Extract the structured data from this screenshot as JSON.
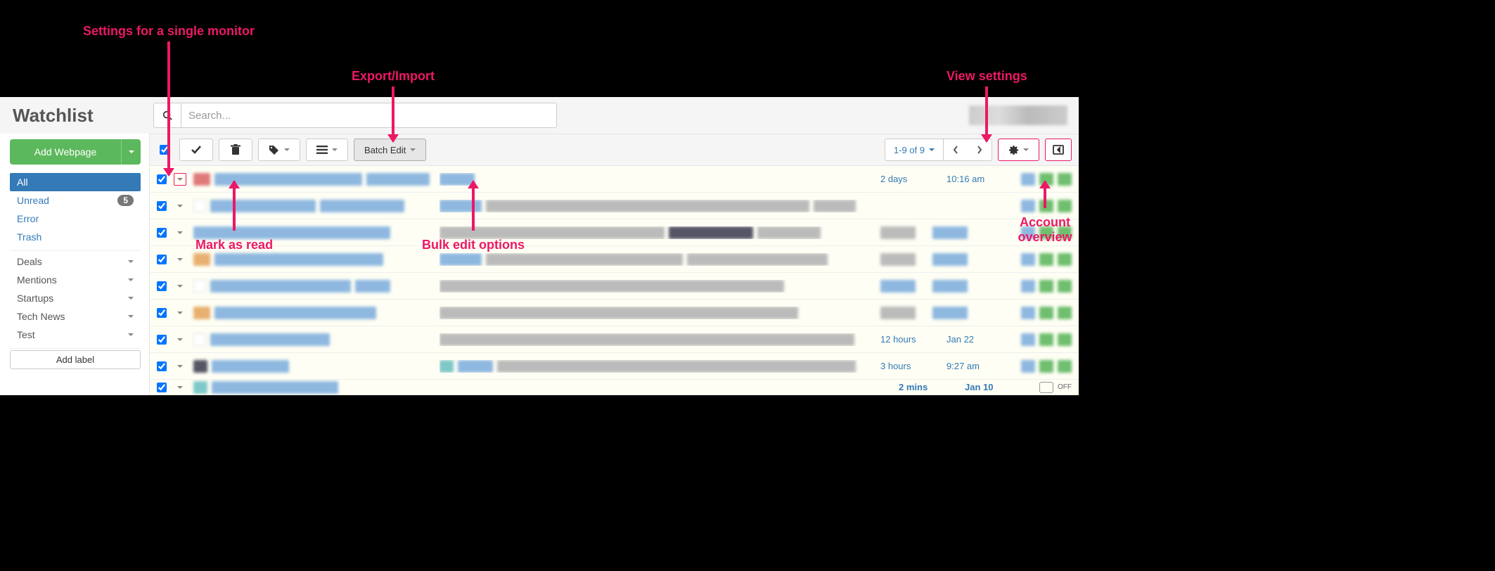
{
  "header": {
    "title": "Watchlist",
    "search_placeholder": "Search..."
  },
  "sidebar": {
    "add_webpage": "Add Webpage",
    "filters": [
      {
        "label": "All",
        "active": true
      },
      {
        "label": "Unread",
        "badge": "5"
      },
      {
        "label": "Error"
      },
      {
        "label": "Trash"
      }
    ],
    "labels": [
      {
        "name": "Deals"
      },
      {
        "name": "Mentions"
      },
      {
        "name": "Startups"
      },
      {
        "name": "Tech News"
      },
      {
        "name": "Test"
      }
    ],
    "add_label": "Add label"
  },
  "toolbar": {
    "batch_edit": "Batch Edit",
    "pager": "1-9 of 9"
  },
  "rows": [
    {
      "date": "2 days",
      "time": "10:16 am"
    },
    {
      "date": "",
      "time": ""
    },
    {
      "date": "",
      "time": ""
    },
    {
      "date": "",
      "time": ""
    },
    {
      "date": "",
      "time": ""
    },
    {
      "date": "",
      "time": ""
    },
    {
      "date": "12 hours",
      "time": "Jan 22"
    },
    {
      "date": "3 hours",
      "time": "9:27 am"
    },
    {
      "date": "2 mins",
      "time": "Jan 10"
    }
  ],
  "last_off": "OFF",
  "callouts": {
    "single_monitor": "Settings for a single monitor",
    "export_import": "Export/Import",
    "view_settings": "View settings",
    "mark_read": "Mark as read",
    "bulk_edit": "Bulk edit options",
    "account_overview": "Account\noverview"
  }
}
